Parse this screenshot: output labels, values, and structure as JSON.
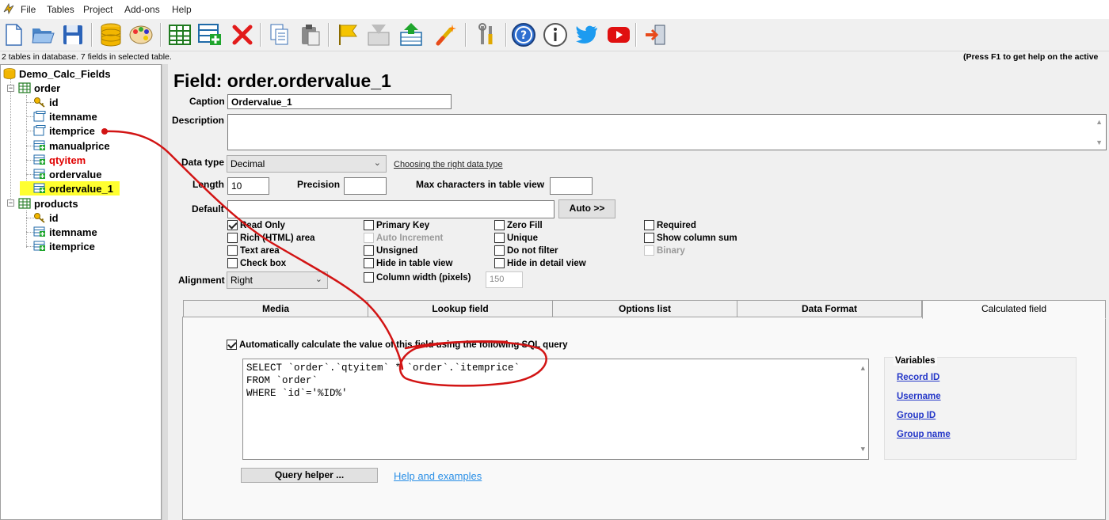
{
  "menubar": {
    "items": [
      "File",
      "Tables",
      "Project",
      "Add-ons",
      "Help"
    ]
  },
  "toolbar": {
    "icons": [
      "new-file-icon",
      "open-folder-icon",
      "save-icon",
      "database-icon",
      "palette-icon",
      "table-grid-icon",
      "add-field-icon",
      "delete-icon",
      "copy-icon",
      "paste-icon",
      "flag-icon",
      "import-icon",
      "export-icon",
      "magic-wand-icon",
      "tools-icon",
      "help-icon",
      "info-icon",
      "twitter-icon",
      "youtube-icon",
      "exit-icon"
    ]
  },
  "status": {
    "left": "2 tables in database. 7 fields in selected table.",
    "right": "(Press F1 to get help on the active"
  },
  "tree": {
    "database": "Demo_Calc_Fields",
    "tables": [
      {
        "name": "order",
        "fields": [
          {
            "name": "id",
            "kind": "key"
          },
          {
            "name": "itemname",
            "kind": "text"
          },
          {
            "name": "itemprice",
            "kind": "text"
          },
          {
            "name": "manualprice",
            "kind": "calc"
          },
          {
            "name": "qtyitem",
            "kind": "calc",
            "highlight": "red"
          },
          {
            "name": "ordervalue",
            "kind": "calc"
          },
          {
            "name": "ordervalue_1",
            "kind": "calc",
            "selected": true
          }
        ]
      },
      {
        "name": "products",
        "fields": [
          {
            "name": "id",
            "kind": "key"
          },
          {
            "name": "itemname",
            "kind": "calc"
          },
          {
            "name": "itemprice",
            "kind": "calc"
          }
        ]
      }
    ]
  },
  "field": {
    "title": "Field: order.ordervalue_1",
    "caption_label": "Caption",
    "caption_value": "Ordervalue_1",
    "description_label": "Description",
    "description_value": "",
    "datatype_label": "Data type",
    "datatype_value": "Decimal",
    "datatype_help": "Choosing the right data type",
    "length_label": "Length",
    "length_value": "10",
    "precision_label": "Precision",
    "precision_value": "",
    "maxchars_label": "Max characters in table view",
    "maxchars_value": "",
    "default_label": "Default",
    "default_value": "",
    "auto_button": "Auto >>",
    "alignment_label": "Alignment",
    "alignment_value": "Right",
    "column_width_value": "150"
  },
  "options": {
    "col1": [
      {
        "label": "Read Only",
        "checked": true
      },
      {
        "label": "Rich (HTML) area",
        "checked": false
      },
      {
        "label": "Text area",
        "checked": false
      },
      {
        "label": "Check box",
        "checked": false
      }
    ],
    "col2": [
      {
        "label": "Primary Key",
        "checked": false
      },
      {
        "label": "Auto Increment",
        "checked": false,
        "disabled": true
      },
      {
        "label": "Unsigned",
        "checked": false
      },
      {
        "label": "Hide in table view",
        "checked": false
      },
      {
        "label": "Column width (pixels)",
        "checked": false
      }
    ],
    "col3": [
      {
        "label": "Zero Fill",
        "checked": false
      },
      {
        "label": "Unique",
        "checked": false
      },
      {
        "label": "Do not filter",
        "checked": false
      },
      {
        "label": "Hide in detail view",
        "checked": false
      }
    ],
    "col4": [
      {
        "label": "Required",
        "checked": false
      },
      {
        "label": "Show column sum",
        "checked": false
      },
      {
        "label": "Binary",
        "checked": false,
        "disabled": true
      }
    ]
  },
  "tabs": [
    "Media",
    "Lookup field",
    "Options list",
    "Data Format",
    "Calculated field"
  ],
  "calculated": {
    "auto_label": "Automatically calculate the value of this field using the following SQL query",
    "auto_checked": true,
    "sql_lines": [
      "SELECT `order`.`qtyitem` * `order`.`itemprice`",
      "FROM `order`",
      "WHERE `id`='%ID%'"
    ],
    "query_helper_button": "Query helper ...",
    "help_link": "Help and examples",
    "variables_title": "Variables",
    "variables": [
      "Record ID",
      "Username",
      "Group ID",
      "Group name"
    ]
  },
  "colors": {
    "annotation_red": "#d21414",
    "selection_yellow": "#ffff30",
    "link_blue": "#2437c8",
    "help_link_blue": "#2a8fe6"
  }
}
